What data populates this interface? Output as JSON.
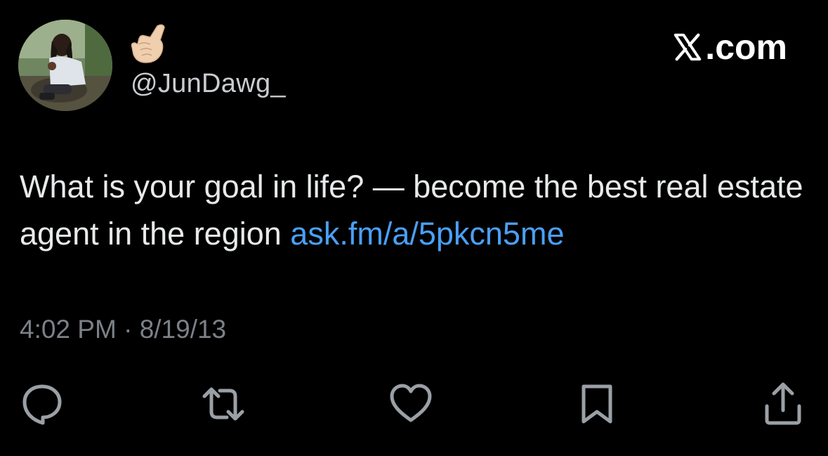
{
  "author": {
    "handle": "@JunDawg_",
    "emoji": "call-me-hand-emoji"
  },
  "brand": {
    "label": ".com",
    "logo": "x-logo-icon"
  },
  "tweet": {
    "text": "What is your goal in life? — become the best real estate agent in the region ",
    "link": "ask.fm/a/5pkcn5me",
    "link_color": "#4a9ff5"
  },
  "meta": {
    "time": "4:02 PM",
    "separator": " · ",
    "date": "8/19/13"
  },
  "actions": [
    {
      "icon": "reply-icon"
    },
    {
      "icon": "retweet-icon"
    },
    {
      "icon": "like-icon"
    },
    {
      "icon": "bookmark-icon"
    },
    {
      "icon": "share-icon"
    }
  ],
  "colors": {
    "background": "#000000",
    "text": "#e7e9ea",
    "muted": "#7c8187",
    "icon": "#9aa0a6"
  }
}
